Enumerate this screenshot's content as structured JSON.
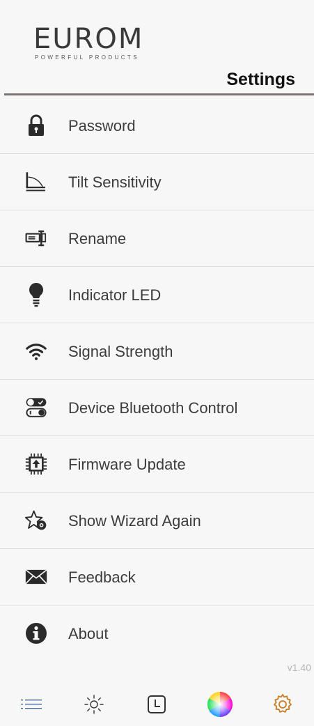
{
  "brand": {
    "name": "EUROM",
    "tagline": "POWERFUL PRODUCTS"
  },
  "header": {
    "title": "Settings"
  },
  "menu": {
    "items": [
      {
        "label": "Password",
        "icon": "padlock-icon"
      },
      {
        "label": "Tilt Sensitivity",
        "icon": "tilt-angle-icon"
      },
      {
        "label": "Rename",
        "icon": "rename-cursor-icon"
      },
      {
        "label": "Indicator LED",
        "icon": "lightbulb-icon"
      },
      {
        "label": "Signal Strength",
        "icon": "wifi-signal-icon"
      },
      {
        "label": "Device Bluetooth Control",
        "icon": "toggle-switches-icon"
      },
      {
        "label": "Firmware Update",
        "icon": "chip-upload-icon"
      },
      {
        "label": "Show Wizard Again",
        "icon": "star-wizard-icon"
      },
      {
        "label": "Feedback",
        "icon": "envelope-icon"
      },
      {
        "label": "About",
        "icon": "info-icon"
      }
    ]
  },
  "version": "v1.40",
  "bottom_nav": {
    "items": [
      {
        "icon": "list-icon"
      },
      {
        "icon": "brightness-icon"
      },
      {
        "icon": "clock-icon"
      },
      {
        "icon": "color-wheel-icon"
      },
      {
        "icon": "gear-icon",
        "active_color": "#c77b22"
      }
    ]
  },
  "colors": {
    "accent": "#c77b22",
    "header_rule": "#7c7470",
    "icon": "#2b2b2b"
  }
}
